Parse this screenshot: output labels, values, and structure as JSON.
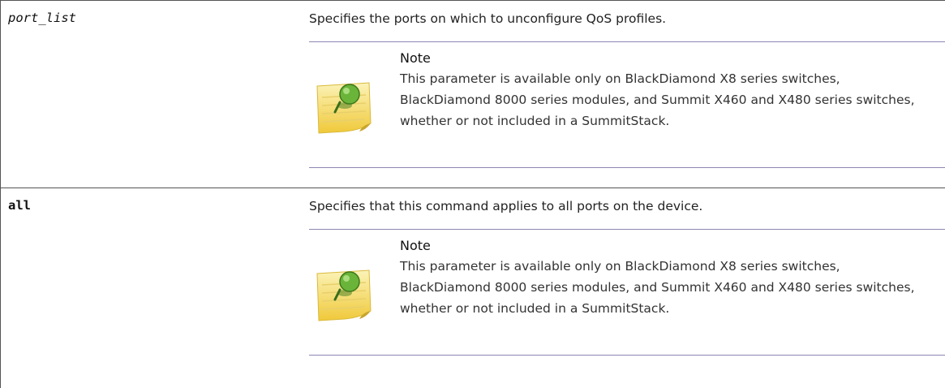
{
  "rows": [
    {
      "param": "port_list",
      "description": "Specifies the ports on which to unconfigure QoS profiles.",
      "note": {
        "title": "Note",
        "icon": "pushpin-note-icon",
        "body": "This parameter is available only on BlackDiamond X8 series switches, BlackDiamond 8000 series modules, and Summit X460 and X480 series switches, whether or not included in a SummitStack."
      }
    },
    {
      "param": "all",
      "description": "Specifies that this command applies to all ports on the device.",
      "note": {
        "title": "Note",
        "icon": "pushpin-note-icon",
        "body": "This parameter is available only on BlackDiamond X8 series switches, BlackDiamond 8000 series modules, and Summit X460 and X480 series switches, whether or not included in a SummitStack."
      }
    }
  ],
  "colors": {
    "table_border": "#555555",
    "note_rule": "#8e86b2",
    "note_paper": "#f5e27a",
    "pin": "#5aa02c"
  }
}
